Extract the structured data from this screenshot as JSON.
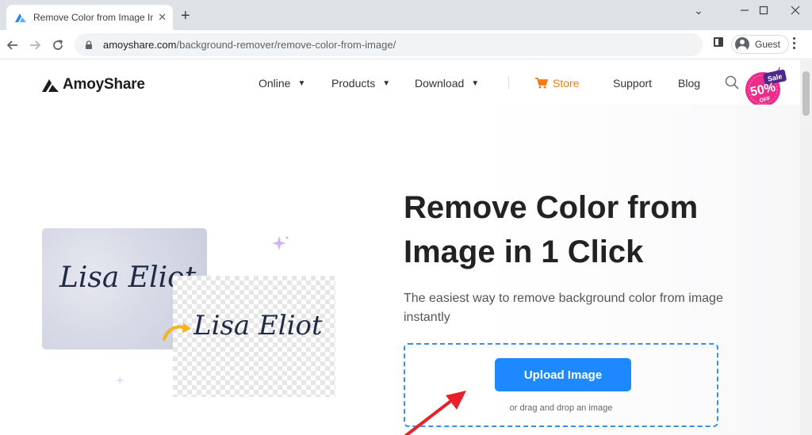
{
  "browser": {
    "tab_title": "Remove Color from Image Instan",
    "url_host": "amoyshare.com",
    "url_path": "/background-remover/remove-color-from-image/",
    "profile_label": "Guest"
  },
  "site": {
    "brand": "AmoyShare",
    "nav": {
      "online": "Online",
      "products": "Products",
      "download": "Download",
      "store": "Store",
      "support": "Support",
      "blog": "Blog"
    },
    "sale_badge": {
      "tag": "Sale",
      "percent": "50%",
      "off": "OFF"
    }
  },
  "hero": {
    "title_line1": "Remove Color from",
    "title_line2": "Image in 1 Click",
    "description": "The easiest way to remove background color from image instantly",
    "upload_button": "Upload Image",
    "drop_hint": "or drag and drop an image",
    "signature_text": "Lisa Eliot"
  },
  "colors": {
    "accent": "#1e88ff",
    "store": "#f07c13",
    "annotation_arrow": "#e8202a",
    "sale_pink": "#ec2b8c",
    "sale_purple": "#4b2a8a"
  }
}
